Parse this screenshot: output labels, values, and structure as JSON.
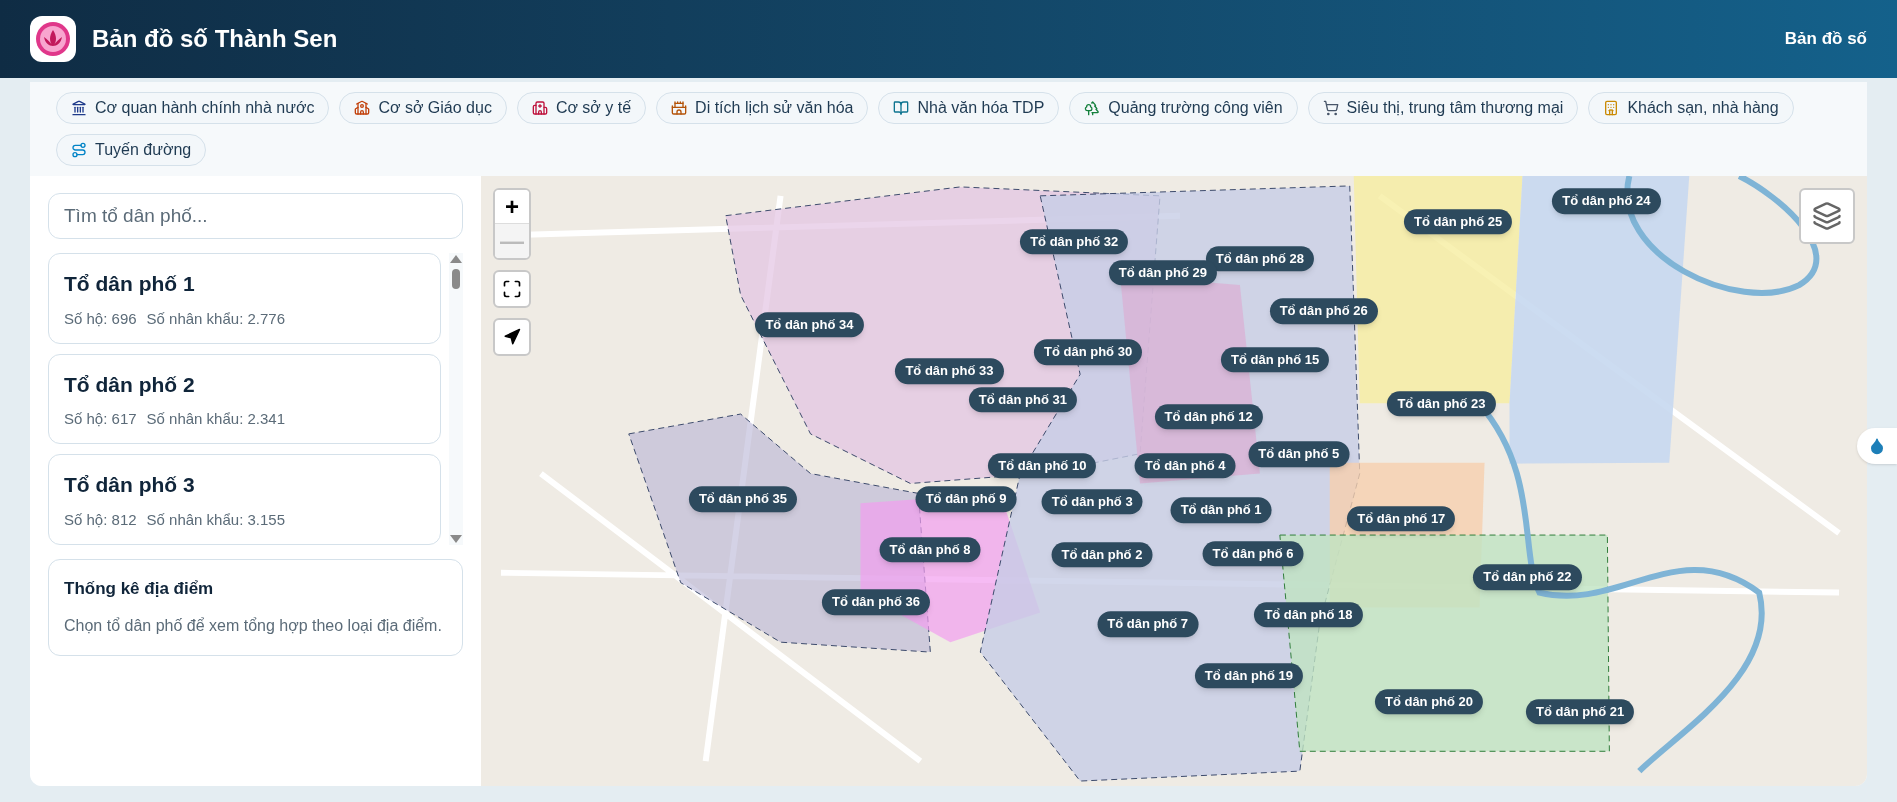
{
  "header": {
    "title": "Bản đồ số Thành Sen",
    "nav": [
      {
        "label": "Bản đồ số",
        "selected": true
      }
    ]
  },
  "categories": [
    {
      "kind": "government",
      "label": "Cơ quan hành chính nhà nước"
    },
    {
      "kind": "education",
      "label": "Cơ sở Giáo dục"
    },
    {
      "kind": "health",
      "label": "Cơ sở y tế"
    },
    {
      "kind": "heritage",
      "label": "Di tích lịch sử văn hóa"
    },
    {
      "kind": "culture",
      "label": "Nhà văn hóa TDP"
    },
    {
      "kind": "park",
      "label": "Quảng trường công viên"
    },
    {
      "kind": "market",
      "label": "Siêu thị, trung tâm thương mại"
    },
    {
      "kind": "hotel",
      "label": "Khách sạn, nhà hàng"
    },
    {
      "kind": "route",
      "label": "Tuyến đường"
    }
  ],
  "sidebar": {
    "search": {
      "placeholder": "Tìm tổ dân phố..."
    },
    "groups": [
      {
        "name": "Tổ dân phố 1",
        "households": "Số hộ: 696",
        "population": "Số nhân khẩu: 2.776"
      },
      {
        "name": "Tổ dân phố 2",
        "households": "Số hộ: 617",
        "population": "Số nhân khẩu: 2.341"
      },
      {
        "name": "Tổ dân phố 3",
        "households": "Số hộ: 812",
        "population": "Số nhân khẩu: 3.155"
      }
    ],
    "stats": {
      "title": "Thống kê địa điểm",
      "text": "Chọn tổ dân phố để xem tổng hợp theo loại địa điểm."
    }
  },
  "map": {
    "controls": [
      {
        "label": "+",
        "disabled": false
      },
      {
        "label": "—",
        "disabled": true
      }
    ],
    "labels": [
      "Tổ dân phố 24",
      "Tổ dân phố 25",
      "Tổ dân phố 32",
      "Tổ dân phố 28",
      "Tổ dân phố 29",
      "Tổ dân phố 26",
      "Tổ dân phố 34",
      "Tổ dân phố 30",
      "Tổ dân phố 15",
      "Tổ dân phố 33",
      "Tổ dân phố 31",
      "Tổ dân phố 23",
      "Tổ dân phố 12",
      "Tổ dân phố 5",
      "Tổ dân phố 10",
      "Tổ dân phố 4",
      "Tổ dân phố 35",
      "Tổ dân phố 9",
      "Tổ dân phố 3",
      "Tổ dân phố 1",
      "Tổ dân phố 17",
      "Tổ dân phố 8",
      "Tổ dân phố 2",
      "Tổ dân phố 6",
      "Tổ dân phố 22",
      "Tổ dân phố 36",
      "Tổ dân phố 18",
      "Tổ dân phố 7",
      "Tổ dân phố 19",
      "Tổ dân phố 20",
      "Tổ dân phố 21"
    ]
  }
}
